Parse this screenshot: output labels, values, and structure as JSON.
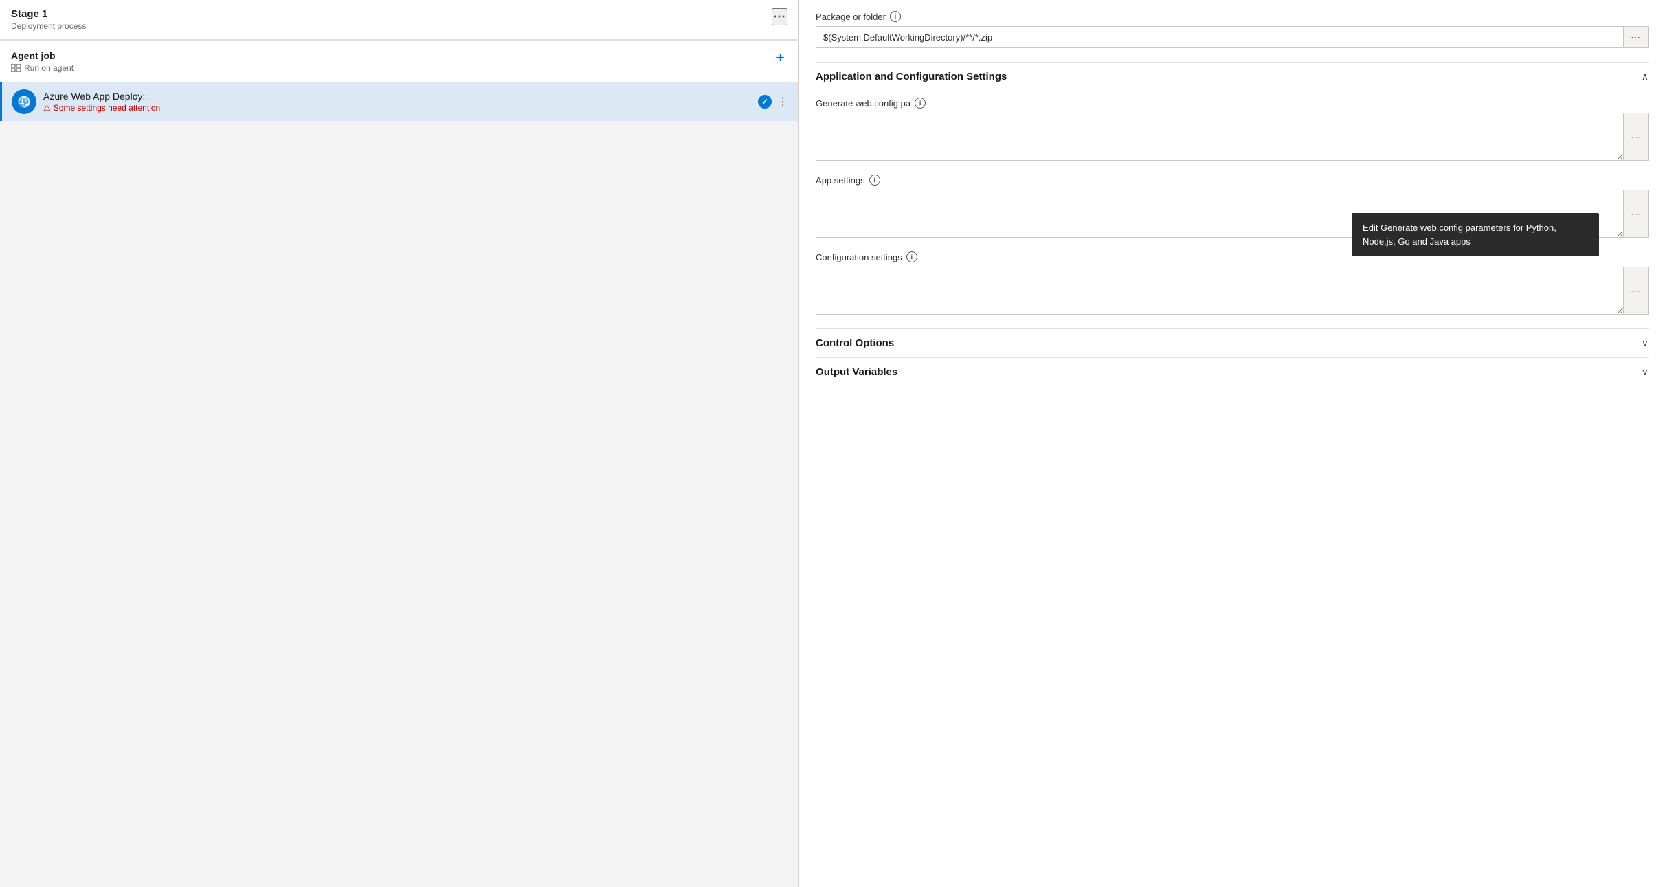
{
  "left": {
    "stage": {
      "title": "Stage 1",
      "subtitle": "Deployment process",
      "more_icon": "⋯"
    },
    "agent_job": {
      "title": "Agent job",
      "subtitle": "Run on agent",
      "add_label": "+"
    },
    "task": {
      "name": "Azure Web App Deploy:",
      "warning": "Some settings need attention",
      "dots": "⋮"
    }
  },
  "right": {
    "package_field": {
      "label": "Package or folder",
      "value": "$(System.DefaultWorkingDirectory)/**/*.zip"
    },
    "app_config_section": {
      "title": "Application and Configuration Settings",
      "chevron": "∧"
    },
    "generate_webconfig": {
      "label": "Generate web.config pa",
      "value": ""
    },
    "app_settings": {
      "label": "App settings",
      "value": ""
    },
    "config_settings": {
      "label": "Configuration settings",
      "value": ""
    },
    "control_options": {
      "title": "Control Options",
      "chevron": "∨"
    },
    "output_variables": {
      "title": "Output Variables",
      "chevron": "∨"
    },
    "tooltip": {
      "text": "Edit Generate web.config parameters for Python, Node.js, Go and Java apps"
    },
    "ellipsis": "⋯"
  }
}
